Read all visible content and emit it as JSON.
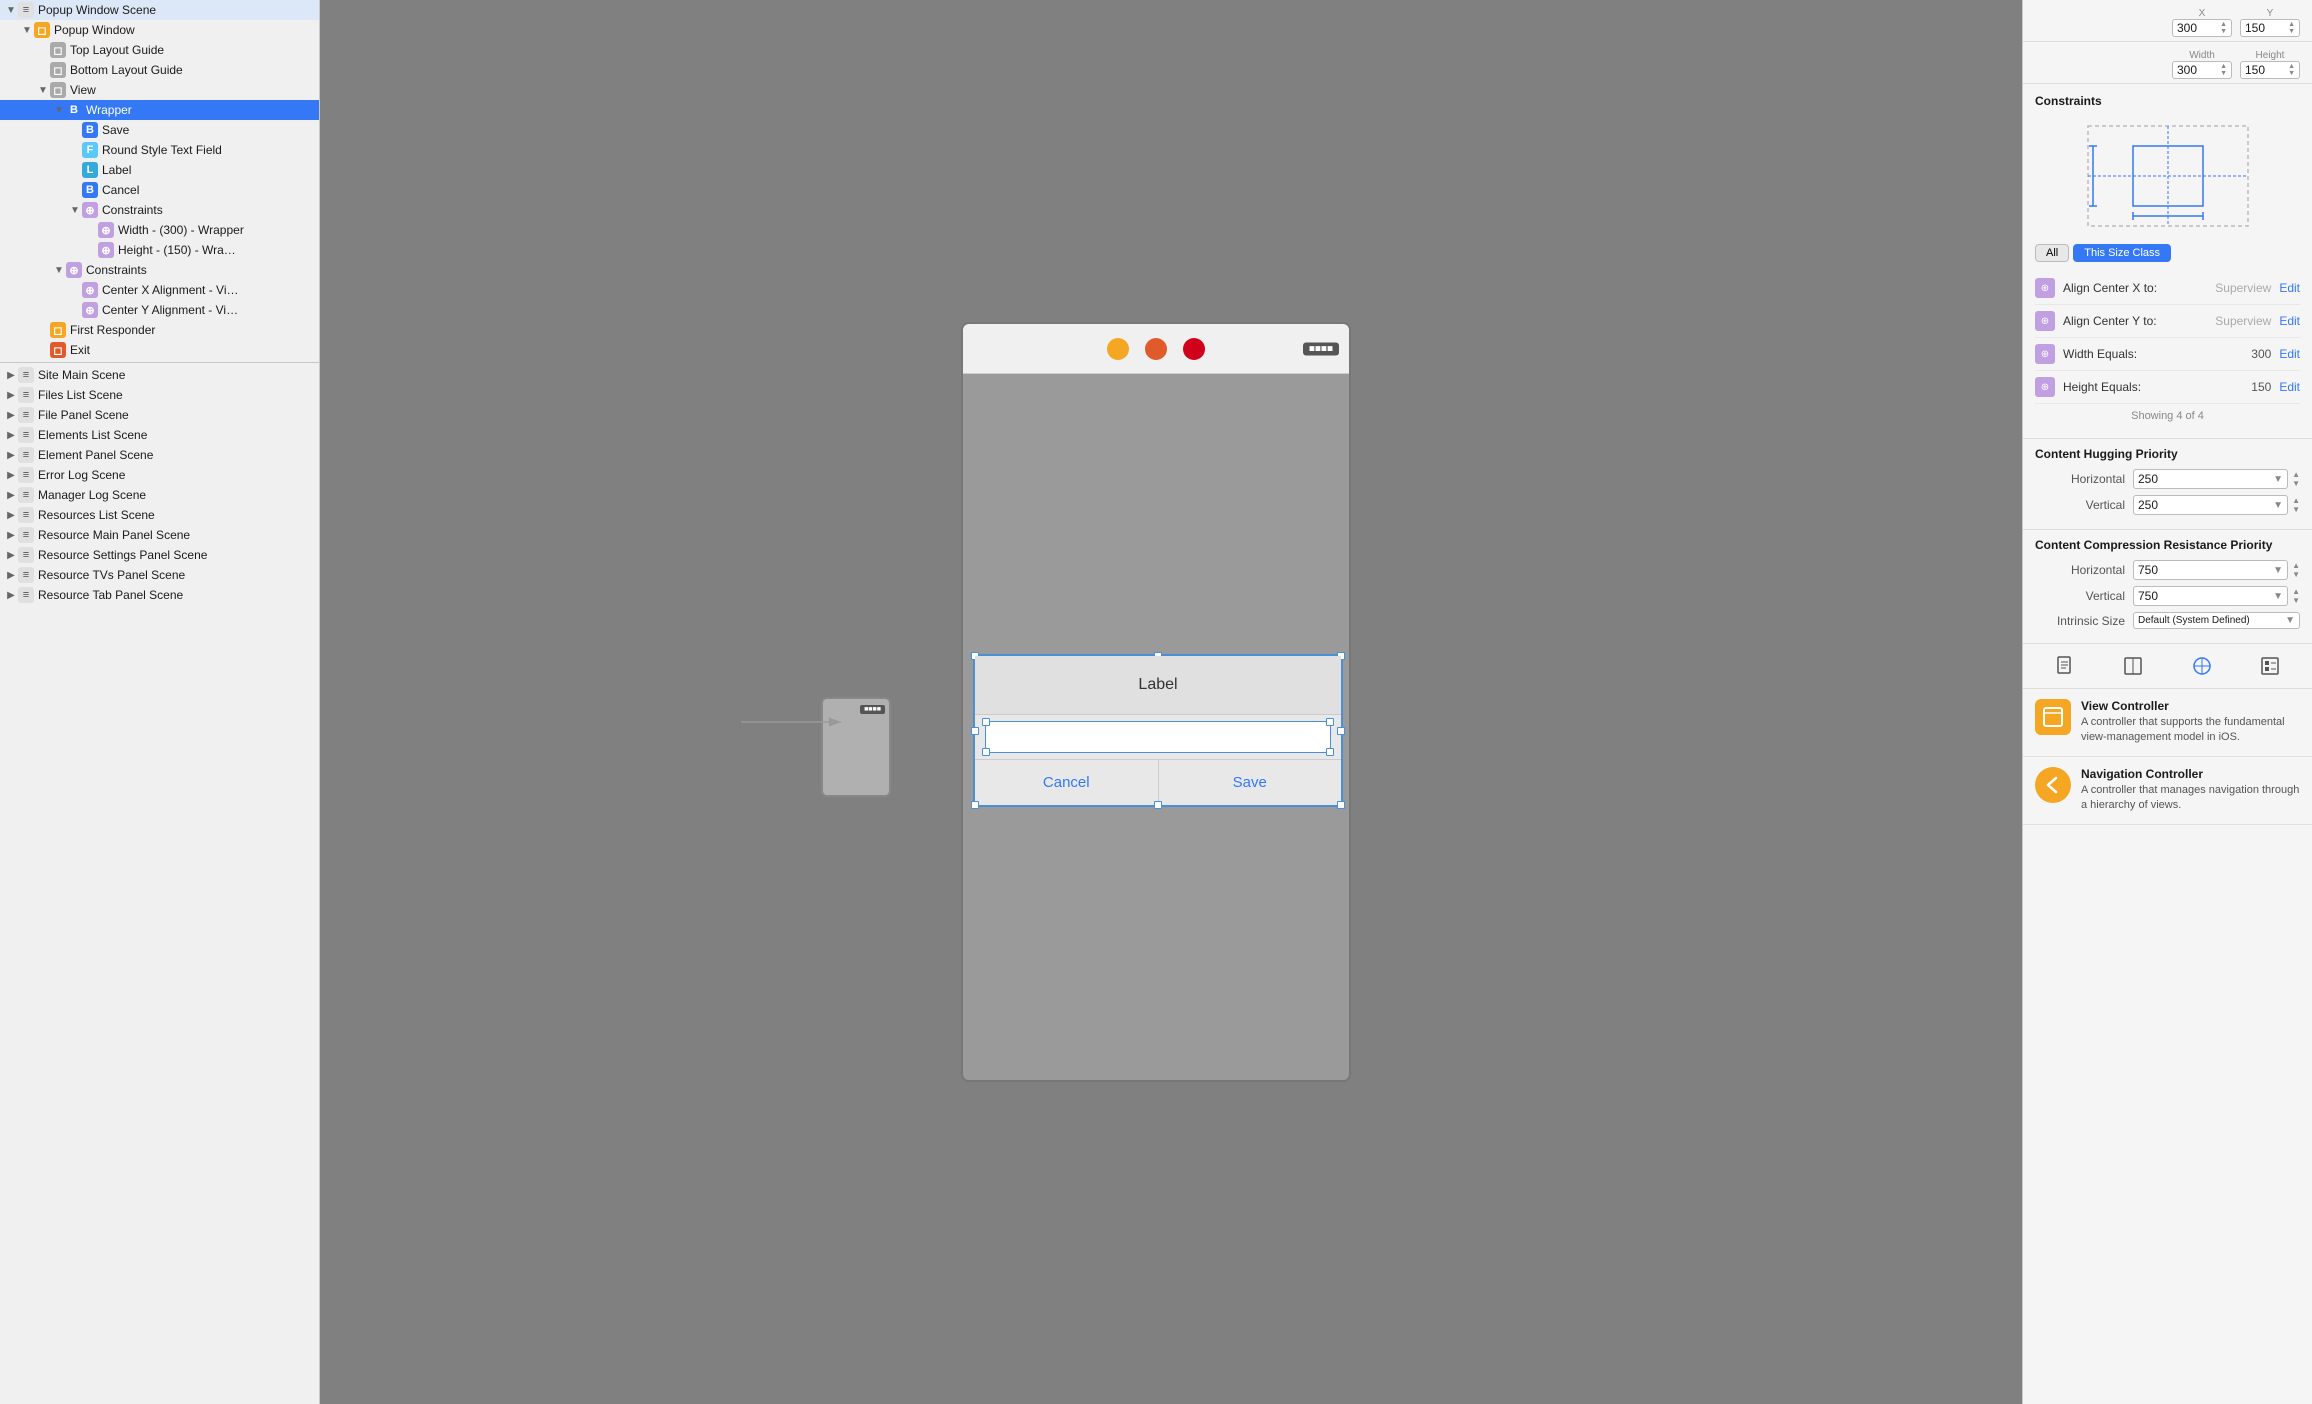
{
  "leftPanel": {
    "treeItems": [
      {
        "id": "popup-window-scene",
        "label": "Popup Window Scene",
        "indent": 0,
        "toggle": "▼",
        "iconType": "scene",
        "iconText": "≡"
      },
      {
        "id": "popup-window",
        "label": "Popup Window",
        "indent": 1,
        "toggle": "▼",
        "iconType": "orange",
        "iconText": "◻"
      },
      {
        "id": "top-layout-guide",
        "label": "Top Layout Guide",
        "indent": 2,
        "toggle": "",
        "iconType": "gray-sq",
        "iconText": "◻"
      },
      {
        "id": "bottom-layout-guide",
        "label": "Bottom Layout Guide",
        "indent": 2,
        "toggle": "",
        "iconType": "gray-sq",
        "iconText": "◻"
      },
      {
        "id": "view",
        "label": "View",
        "indent": 2,
        "toggle": "▼",
        "iconType": "gray-sq",
        "iconText": "◻"
      },
      {
        "id": "wrapper",
        "label": "Wrapper",
        "indent": 3,
        "toggle": "▼",
        "iconType": "blue-b",
        "iconText": "B",
        "selected": true
      },
      {
        "id": "save",
        "label": "Save",
        "indent": 4,
        "toggle": "",
        "iconType": "blue-b",
        "iconText": "B"
      },
      {
        "id": "round-style-text-field",
        "label": "Round Style Text Field",
        "indent": 4,
        "toggle": "",
        "iconType": "blue-f",
        "iconText": "F"
      },
      {
        "id": "label",
        "label": "Label",
        "indent": 4,
        "toggle": "",
        "iconType": "blue-l",
        "iconText": "L"
      },
      {
        "id": "cancel",
        "label": "Cancel",
        "indent": 4,
        "toggle": "",
        "iconType": "blue-b",
        "iconText": "B"
      },
      {
        "id": "constraints-wrapper",
        "label": "Constraints",
        "indent": 4,
        "toggle": "▼",
        "iconType": "constraint",
        "iconText": "⊕"
      },
      {
        "id": "width-constraint",
        "label": "Width - (300) - Wrapper",
        "indent": 5,
        "toggle": "",
        "iconType": "constraint",
        "iconText": "⊕"
      },
      {
        "id": "height-constraint",
        "label": "Height - (150) - Wra…",
        "indent": 5,
        "toggle": "",
        "iconType": "constraint",
        "iconText": "⊕"
      },
      {
        "id": "constraints-view",
        "label": "Constraints",
        "indent": 3,
        "toggle": "▼",
        "iconType": "constraint",
        "iconText": "⊕"
      },
      {
        "id": "center-x",
        "label": "Center X Alignment - Vi…",
        "indent": 4,
        "toggle": "",
        "iconType": "constraint",
        "iconText": "⊕"
      },
      {
        "id": "center-y",
        "label": "Center Y Alignment - Vi…",
        "indent": 4,
        "toggle": "",
        "iconType": "constraint",
        "iconText": "⊕"
      },
      {
        "id": "first-responder",
        "label": "First Responder",
        "indent": 2,
        "toggle": "",
        "iconType": "first-responder",
        "iconText": "◻"
      },
      {
        "id": "exit",
        "label": "Exit",
        "indent": 2,
        "toggle": "",
        "iconType": "exit",
        "iconText": "◻"
      }
    ],
    "sceneItems": [
      {
        "id": "site-main-scene",
        "label": "Site Main Scene"
      },
      {
        "id": "files-list-scene",
        "label": "Files List Scene"
      },
      {
        "id": "file-panel-scene",
        "label": "File Panel Scene"
      },
      {
        "id": "elements-list-scene",
        "label": "Elements List Scene"
      },
      {
        "id": "element-panel-scene",
        "label": "Element Panel Scene"
      },
      {
        "id": "error-log-scene",
        "label": "Error Log Scene"
      },
      {
        "id": "manager-log-scene",
        "label": "Manager Log Scene"
      },
      {
        "id": "resources-list-scene",
        "label": "Resources List Scene"
      },
      {
        "id": "resource-main-panel-scene",
        "label": "Resource Main Panel Scene"
      },
      {
        "id": "resource-settings-panel-scene",
        "label": "Resource Settings Panel Scene"
      },
      {
        "id": "resource-tvs-panel-scene",
        "label": "Resource TVs Panel Scene"
      },
      {
        "id": "resource-tab-panel-scene",
        "label": "Resource Tab Panel Scene"
      }
    ]
  },
  "canvas": {
    "statusIcons": [
      "◻",
      "◻",
      "◻"
    ],
    "batteryLabel": "■■■■",
    "labelText": "Label",
    "cancelText": "Cancel",
    "saveText": "Save"
  },
  "rightPanel": {
    "coords": {
      "xLabel": "X",
      "xValue": "300",
      "yLabel": "Y",
      "yValue": "150",
      "widthLabel": "Width",
      "widthValue": "300",
      "heightLabel": "Height",
      "heightValue": "150"
    },
    "constraintsTitle": "Constraints",
    "sizeClassButtons": [
      "All",
      "This Size Class"
    ],
    "constraints": [
      {
        "label": "Align Center X to:",
        "superview": "Superview",
        "edit": "Edit"
      },
      {
        "label": "Align Center Y to:",
        "superview": "Superview",
        "edit": "Edit"
      },
      {
        "label": "Width Equals:",
        "value": "300",
        "edit": "Edit"
      },
      {
        "label": "Height Equals:",
        "value": "150",
        "edit": "Edit"
      }
    ],
    "showingLabel": "Showing 4 of 4",
    "contentHuggingTitle": "Content Hugging Priority",
    "horizontalLabel": "Horizontal",
    "horizontalValue": "250",
    "verticalLabel": "Vertical",
    "verticalValue": "250",
    "compressionTitle": "Content Compression Resistance Priority",
    "compHorizontalValue": "750",
    "compVerticalValue": "750",
    "intrinsicLabel": "Intrinsic Size",
    "intrinsicValue": "Default (System Defined)",
    "libraryItems": [
      {
        "id": "view-controller",
        "title": "View Controller",
        "description": "A controller that supports the fundamental view-management model in iOS."
      },
      {
        "id": "navigation-controller",
        "title": "Navigation Controller",
        "description": "A controller that manages navigation through a hierarchy of views."
      }
    ]
  }
}
